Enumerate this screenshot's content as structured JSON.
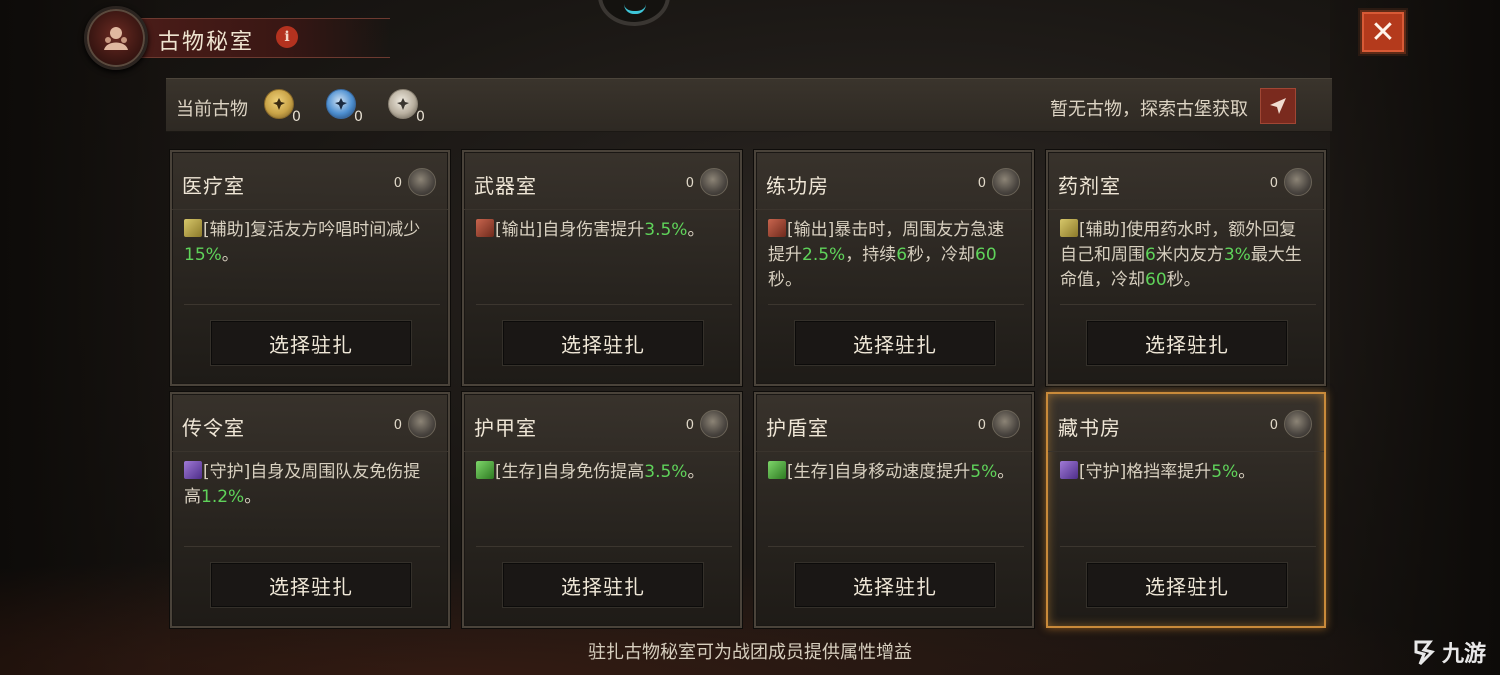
{
  "window": {
    "title": "古物秘室",
    "info_label": "i",
    "close_label": "✕"
  },
  "relic_bar": {
    "label": "当前古物",
    "relics": [
      {
        "color": "#c9a347",
        "count": "0"
      },
      {
        "color": "#4d8fd0",
        "count": "0"
      },
      {
        "color": "#b9b0a0",
        "count": "0"
      }
    ],
    "hint": "暂无古物，探索古堡获取"
  },
  "rooms": [
    {
      "name": "医疗室",
      "count": "0",
      "tag_icon": "assist",
      "tag": "[辅助]",
      "desc": [
        {
          "t": "复活友方吟唱时间减少"
        },
        {
          "t": "15%",
          "hl": true
        },
        {
          "t": "。"
        }
      ],
      "button": "选择驻扎"
    },
    {
      "name": "武器室",
      "count": "0",
      "tag_icon": "output",
      "tag": "[输出]",
      "desc": [
        {
          "t": "自身伤害提升"
        },
        {
          "t": "3.5%",
          "hl": true
        },
        {
          "t": "。"
        }
      ],
      "button": "选择驻扎"
    },
    {
      "name": "练功房",
      "count": "0",
      "tag_icon": "output",
      "tag": "[输出]",
      "desc": [
        {
          "t": "暴击时，周围友方急速提升"
        },
        {
          "t": "2.5%",
          "hl": true
        },
        {
          "t": "，持续"
        },
        {
          "t": "6",
          "hl": true
        },
        {
          "t": "秒，冷却"
        },
        {
          "t": "60",
          "hl": true
        },
        {
          "t": "秒。"
        }
      ],
      "button": "选择驻扎"
    },
    {
      "name": "药剂室",
      "count": "0",
      "tag_icon": "assist",
      "tag": "[辅助]",
      "desc": [
        {
          "t": "使用药水时，额外回复自己和周围"
        },
        {
          "t": "6",
          "hl": true
        },
        {
          "t": "米内友方"
        },
        {
          "t": "3%",
          "hl": true
        },
        {
          "t": "最大生命值，冷却"
        },
        {
          "t": "60",
          "hl": true
        },
        {
          "t": "秒。"
        }
      ],
      "button": "选择驻扎"
    },
    {
      "name": "传令室",
      "count": "0",
      "tag_icon": "guard",
      "tag": "[守护]",
      "desc": [
        {
          "t": "自身及周围队友免伤提高"
        },
        {
          "t": "1.2%",
          "hl": true
        },
        {
          "t": "。"
        }
      ],
      "button": "选择驻扎"
    },
    {
      "name": "护甲室",
      "count": "0",
      "tag_icon": "survive",
      "tag": "[生存]",
      "desc": [
        {
          "t": "自身免伤提高"
        },
        {
          "t": "3.5%",
          "hl": true
        },
        {
          "t": "。"
        }
      ],
      "button": "选择驻扎"
    },
    {
      "name": "护盾室",
      "count": "0",
      "tag_icon": "survive",
      "tag": "[生存]",
      "desc": [
        {
          "t": "自身移动速度提升"
        },
        {
          "t": "5%",
          "hl": true
        },
        {
          "t": "。"
        }
      ],
      "button": "选择驻扎"
    },
    {
      "name": "藏书房",
      "count": "0",
      "tag_icon": "guard",
      "tag": "[守护]",
      "desc": [
        {
          "t": "格挡率提升"
        },
        {
          "t": "5%",
          "hl": true
        },
        {
          "t": "。"
        }
      ],
      "button": "选择驻扎",
      "highlighted": true
    }
  ],
  "footer": "驻扎古物秘室可为战团成员提供属性增益",
  "watermark": "九游"
}
